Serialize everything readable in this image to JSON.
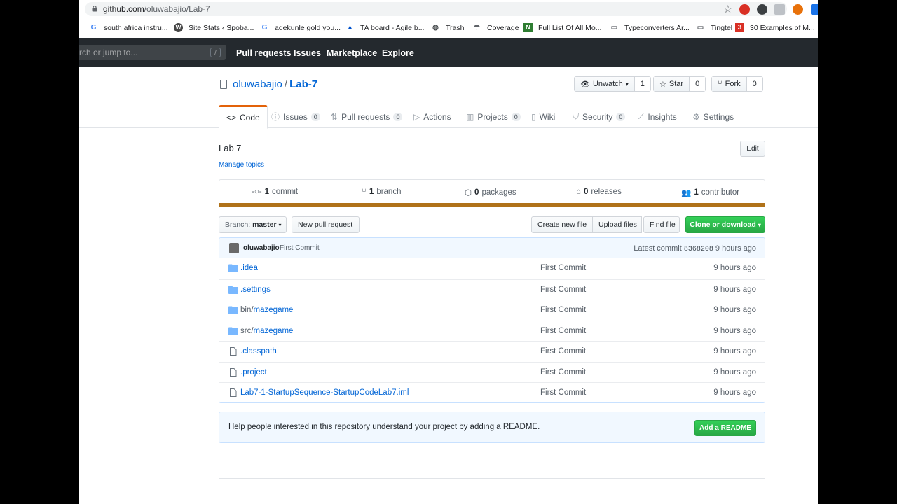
{
  "browser": {
    "url_host": "github.com",
    "url_path": "/oluwabajio/Lab-7",
    "bookmarks": [
      {
        "label": "south africa instru...",
        "icon": "google-icon"
      },
      {
        "label": "Site Stats ‹ Spoba...",
        "icon": "wordpress-icon"
      },
      {
        "label": "adekunle gold you...",
        "icon": "google-icon"
      },
      {
        "label": "TA board - Agile b...",
        "icon": "atlassian-icon"
      },
      {
        "label": "Trash",
        "icon": "globe-icon"
      },
      {
        "label": "Coverage",
        "icon": "coverage-icon"
      },
      {
        "label": "Full List Of All Mo...",
        "icon": "n-icon"
      },
      {
        "label": "Typeconverters Ar...",
        "icon": "folder-icon"
      },
      {
        "label": "Tingtel",
        "icon": "folder-icon"
      },
      {
        "label": "30 Examples of M...",
        "icon": "bookmark-red-icon"
      }
    ]
  },
  "header": {
    "search_placeholder": "rch or jump to...",
    "search_shortcut": "/",
    "nav": [
      "Pull requests",
      "Issues",
      "Marketplace",
      "Explore"
    ]
  },
  "repo": {
    "owner": "oluwabajio",
    "separator": "/",
    "name": "Lab-7",
    "watch_label": "Unwatch",
    "watch_count": "1",
    "star_label": "Star",
    "star_count": "0",
    "fork_label": "Fork",
    "fork_count": "0"
  },
  "tabs": [
    {
      "label": "Code",
      "count": null
    },
    {
      "label": "Issues",
      "count": "0"
    },
    {
      "label": "Pull requests",
      "count": "0"
    },
    {
      "label": "Actions",
      "count": null
    },
    {
      "label": "Projects",
      "count": "0"
    },
    {
      "label": "Wiki",
      "count": null
    },
    {
      "label": "Security",
      "count": "0"
    },
    {
      "label": "Insights",
      "count": null
    },
    {
      "label": "Settings",
      "count": null
    }
  ],
  "description": {
    "text": "Lab 7",
    "manage_topics": "Manage topics",
    "edit_label": "Edit"
  },
  "summary": {
    "commits_num": "1",
    "commits_label": "commit",
    "branches_num": "1",
    "branches_label": "branch",
    "packages_num": "0",
    "packages_label": "packages",
    "releases_num": "0",
    "releases_label": "releases",
    "contributors_num": "1",
    "contributors_label": "contributor",
    "lang_color": "#b07219"
  },
  "filenav": {
    "branch_prefix": "Branch:",
    "branch_name": "master",
    "new_pr": "New pull request",
    "create_file": "Create new file",
    "upload_files": "Upload files",
    "find_file": "Find file",
    "clone": "Clone or download"
  },
  "commit": {
    "author": "oluwabajio",
    "message": "First Commit",
    "latest_label": "Latest commit",
    "sha": "8368208",
    "age": "9 hours ago"
  },
  "files": [
    {
      "type": "dir",
      "prefix": "",
      "name": ".idea",
      "message": "First Commit",
      "age": "9 hours ago"
    },
    {
      "type": "dir",
      "prefix": "",
      "name": ".settings",
      "message": "First Commit",
      "age": "9 hours ago"
    },
    {
      "type": "dir",
      "prefix": "bin/",
      "name": "mazegame",
      "message": "First Commit",
      "age": "9 hours ago"
    },
    {
      "type": "dir",
      "prefix": "src/",
      "name": "mazegame",
      "message": "First Commit",
      "age": "9 hours ago"
    },
    {
      "type": "file",
      "prefix": "",
      "name": ".classpath",
      "message": "First Commit",
      "age": "9 hours ago"
    },
    {
      "type": "file",
      "prefix": "",
      "name": ".project",
      "message": "First Commit",
      "age": "9 hours ago"
    },
    {
      "type": "file",
      "prefix": "",
      "name": "Lab7-1-StartupSequence-StartupCodeLab7.iml",
      "message": "First Commit",
      "age": "9 hours ago"
    }
  ],
  "readme": {
    "text": "Help people interested in this repository understand your project by adding a README.",
    "button": "Add a README"
  },
  "colors": {
    "link": "#0366d6",
    "header_bg": "#24292e",
    "green": "#28a745",
    "tab_accent": "#e36209"
  }
}
